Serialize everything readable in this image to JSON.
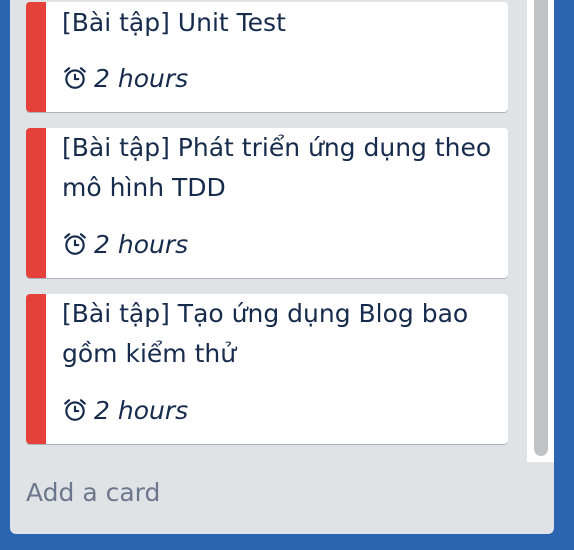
{
  "cards": [
    {
      "title": "[Bài tập] Unit Test",
      "badge_icon": "clock-icon",
      "badge_text": "2 hours",
      "label_color": "#e5403a"
    },
    {
      "title_line1": "[Bài tập] Phát triển ứng dụng theo",
      "title_line2": "mô hình TDD",
      "badge_icon": "clock-icon",
      "badge_text": "2 hours",
      "label_color": "#e5403a"
    },
    {
      "title_line1": "[Bài tập] Tạo ứng dụng Blog bao",
      "title_line2": "gồm kiểm thử",
      "badge_icon": "clock-icon",
      "badge_text": "2 hours",
      "label_color": "#e5403a"
    }
  ],
  "add_card_label": "Add a card"
}
